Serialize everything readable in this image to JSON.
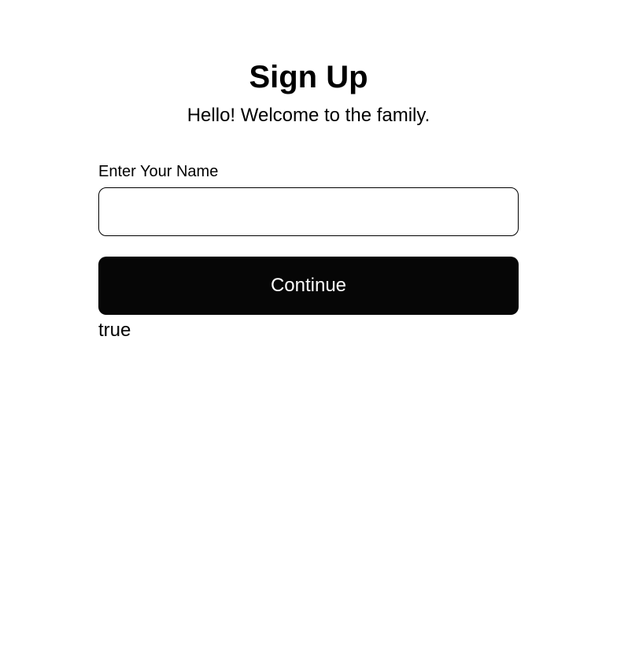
{
  "header": {
    "title": "Sign Up",
    "subtitle": "Hello! Welcome to the family."
  },
  "form": {
    "name_label": "Enter Your Name",
    "name_value": "",
    "continue_label": "Continue"
  },
  "stray": {
    "text": "true"
  }
}
